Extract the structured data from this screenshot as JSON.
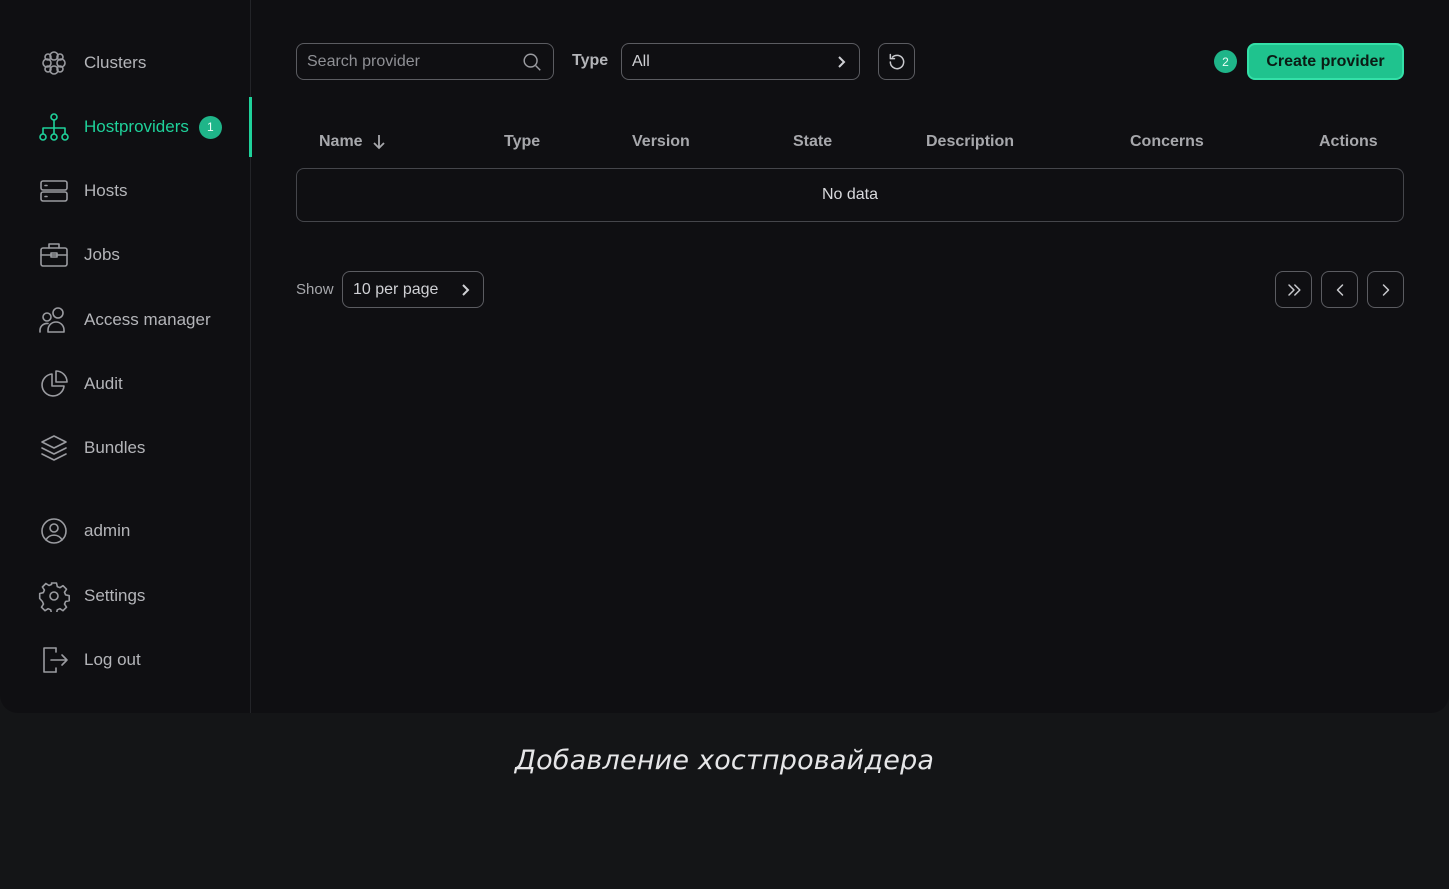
{
  "sidebar": {
    "items": [
      {
        "label": "Clusters",
        "icon": "clusters-icon"
      },
      {
        "label": "Hostproviders",
        "icon": "hierarchy-icon",
        "active": true,
        "badge": "1"
      },
      {
        "label": "Hosts",
        "icon": "server-icon"
      },
      {
        "label": "Jobs",
        "icon": "briefcase-icon"
      },
      {
        "label": "Access manager",
        "icon": "users-icon"
      },
      {
        "label": "Audit",
        "icon": "pie-chart-icon"
      },
      {
        "label": "Bundles",
        "icon": "layers-icon"
      }
    ],
    "bottom_items": [
      {
        "label": "admin",
        "icon": "user-circle-icon"
      },
      {
        "label": "Settings",
        "icon": "gear-icon"
      },
      {
        "label": "Log out",
        "icon": "logout-icon"
      }
    ]
  },
  "toolbar": {
    "search_placeholder": "Search provider",
    "type_label": "Type",
    "type_value": "All",
    "step_badge": "2",
    "create_label": "Create provider"
  },
  "table": {
    "columns": [
      "Name",
      "Type",
      "Version",
      "State",
      "Description",
      "Concerns",
      "Actions"
    ],
    "sort_column": "Name",
    "sort_direction": "descending",
    "empty_text": "No data"
  },
  "pagination": {
    "show_label": "Show",
    "per_page_value": "10 per page"
  },
  "caption": "Добавление хостпровайдера",
  "colors": {
    "accent": "#1fd19a",
    "button": "#1fc38e",
    "background": "#0f0f12"
  }
}
